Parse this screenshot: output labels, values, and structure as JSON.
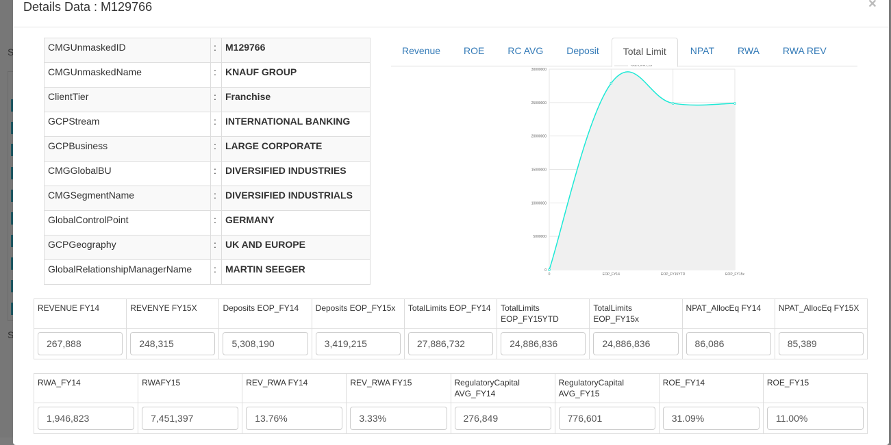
{
  "modal": {
    "title": "Details Data : M129766",
    "close": "×"
  },
  "background": {
    "letters": [
      "S",
      "S"
    ]
  },
  "info": [
    {
      "label": "CMGUnmaskedID",
      "sep": ":",
      "value": "M129766"
    },
    {
      "label": "CMGUnmaskedName",
      "sep": ":",
      "value": "KNAUF GROUP"
    },
    {
      "label": "ClientTier",
      "sep": ":",
      "value": "Franchise"
    },
    {
      "label": "GCPStream",
      "sep": ":",
      "value": "INTERNATIONAL BANKING"
    },
    {
      "label": "GCPBusiness",
      "sep": ":",
      "value": "LARGE CORPORATE"
    },
    {
      "label": "CMGGlobalBU",
      "sep": ":",
      "value": "DIVERSIFIED INDUSTRIES"
    },
    {
      "label": "CMGSegmentName",
      "sep": ":",
      "value": "DIVERSIFIED INDUSTRIALS"
    },
    {
      "label": "GlobalControlPoint",
      "sep": ":",
      "value": "GERMANY"
    },
    {
      "label": "GCPGeography",
      "sep": ":",
      "value": "UK AND EUROPE"
    },
    {
      "label": "GlobalRelationshipManagerName",
      "sep": ":",
      "value": "MARTIN SEEGER"
    }
  ],
  "tabs": [
    {
      "label": "Revenue"
    },
    {
      "label": "ROE"
    },
    {
      "label": "RC AVG"
    },
    {
      "label": "Deposit"
    },
    {
      "label": "Total Limit",
      "active": true
    },
    {
      "label": "NPAT"
    },
    {
      "label": "RWA"
    },
    {
      "label": "RWA REV"
    }
  ],
  "chart_data": {
    "type": "line",
    "categories": [
      "0",
      "EOP_FY14",
      "EOP_FY15YTD",
      "EOP_FY15x"
    ],
    "series": [
      {
        "name": "Total Limit EOP",
        "values": [
          0,
          27886732,
          24886836,
          24886836
        ],
        "color": "#1de9d6",
        "fill": "#f0f0f0"
      }
    ],
    "yticks": [
      "0",
      "5000000",
      "10000000",
      "15000000",
      "20000000",
      "25000000",
      "30000000"
    ],
    "ylim": [
      0,
      30000000
    ],
    "grid": true,
    "legend": "top"
  },
  "metrics1": [
    {
      "label": "REVENUE FY14",
      "value": "267,888"
    },
    {
      "label": "REVENYE FY15X",
      "value": "248,315"
    },
    {
      "label": "Deposits EOP_FY14",
      "value": "5,308,190"
    },
    {
      "label": "Deposits EOP_FY15x",
      "value": "3,419,215"
    },
    {
      "label": "TotalLimits EOP_FY14",
      "value": "27,886,732"
    },
    {
      "label": "TotalLimits EOP_FY15YTD",
      "value": "24,886,836"
    },
    {
      "label": "TotalLimits EOP_FY15x",
      "value": "24,886,836"
    },
    {
      "label": "NPAT_AllocEq FY14",
      "value": "86,086"
    },
    {
      "label": "NPAT_AllocEq FY15X",
      "value": "85,389"
    }
  ],
  "metrics2": [
    {
      "label": "RWA_FY14",
      "value": "1,946,823"
    },
    {
      "label": "RWAFY15",
      "value": "7,451,397"
    },
    {
      "label": "REV_RWA FY14",
      "value": "13.76%"
    },
    {
      "label": "REV_RWA FY15",
      "value": "3.33%"
    },
    {
      "label": "RegulatoryCapital AVG_FY14",
      "value": "276,849"
    },
    {
      "label": "RegulatoryCapital AVG_FY15",
      "value": "776,601"
    },
    {
      "label": "ROE_FY14",
      "value": "31.09%"
    },
    {
      "label": "ROE_FY15",
      "value": "11.00%"
    }
  ]
}
